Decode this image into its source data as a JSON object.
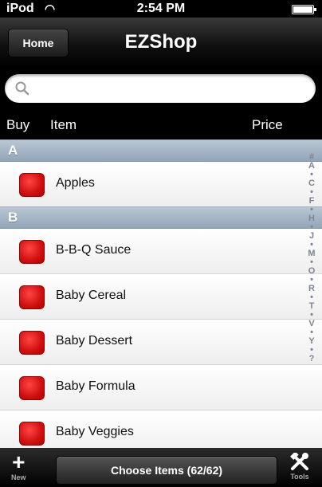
{
  "status": {
    "carrier": "iPod",
    "time": "2:54 PM",
    "wifi_icon": "wifi-icon",
    "battery_icon": "battery-icon"
  },
  "navbar": {
    "home_label": "Home",
    "title": "EZShop"
  },
  "search": {
    "placeholder": "",
    "icon": "search-icon"
  },
  "columns": {
    "buy": "Buy",
    "item": "Item",
    "price": "Price"
  },
  "sections": [
    {
      "letter": "A",
      "items": [
        "Apples"
      ]
    },
    {
      "letter": "B",
      "items": [
        "B-B-Q Sauce",
        "Baby Cereal",
        "Baby Dessert",
        "Baby Formula",
        "Baby Veggies"
      ]
    }
  ],
  "index": [
    "#",
    "A",
    "•",
    "C",
    "•",
    "F",
    "•",
    "H",
    "•",
    "J",
    "•",
    "M",
    "•",
    "O",
    "•",
    "R",
    "•",
    "T",
    "•",
    "V",
    "•",
    "Y",
    "•",
    "?"
  ],
  "toolbar": {
    "new_label": "New",
    "choose_label": "Choose Items (62/62)",
    "tools_label": "Tools"
  },
  "colors": {
    "check_red": "#d01010",
    "section_blue": "#93a5b8"
  }
}
